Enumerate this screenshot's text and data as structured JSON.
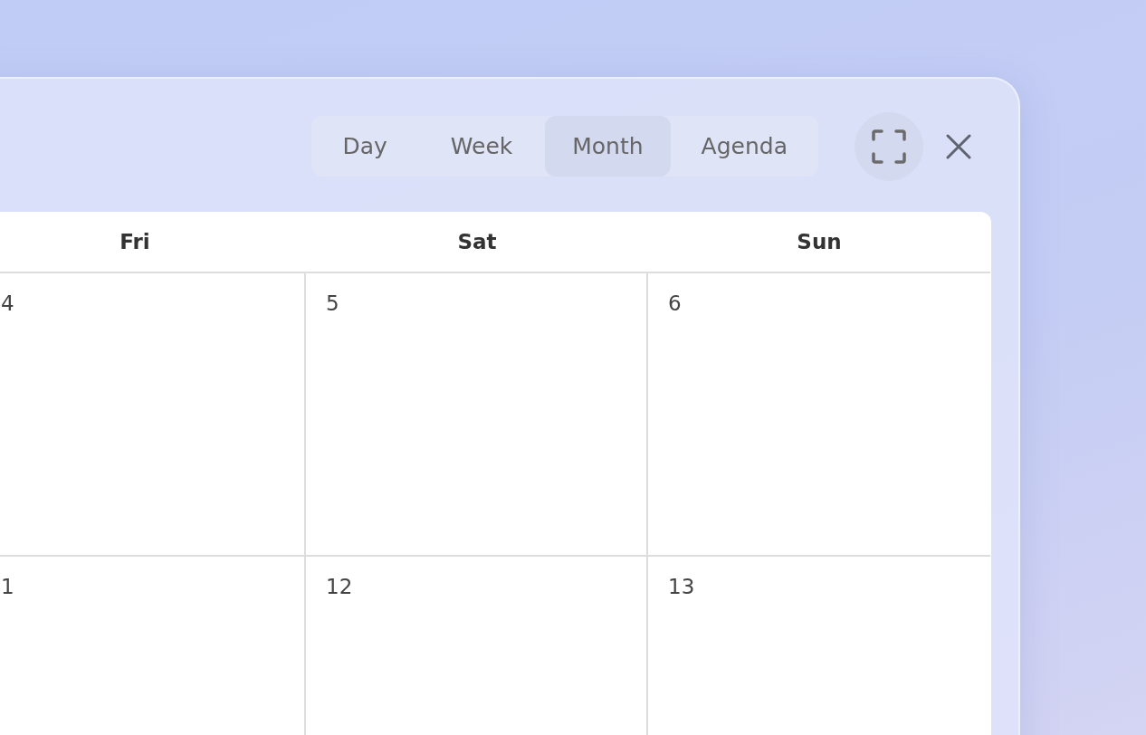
{
  "view_tabs": [
    {
      "label": "Day",
      "selected": false
    },
    {
      "label": "Week",
      "selected": false
    },
    {
      "label": "Month",
      "selected": true
    },
    {
      "label": "Agenda",
      "selected": false
    }
  ],
  "calendar": {
    "weekdays": [
      "Fri",
      "Sat",
      "Sun"
    ],
    "weeks": [
      [
        "4",
        "5",
        "6"
      ],
      [
        "1",
        "12",
        "13"
      ]
    ]
  }
}
